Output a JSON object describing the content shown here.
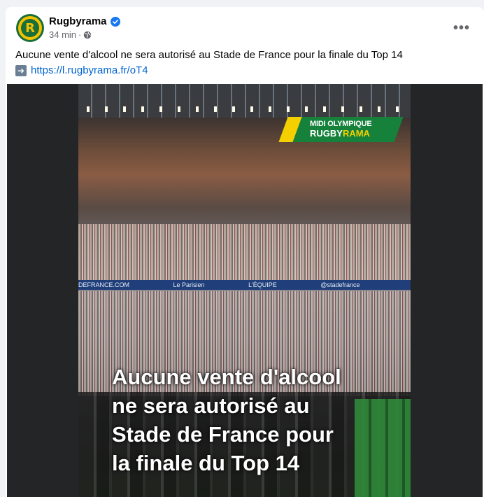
{
  "post": {
    "page_name": "Rugbyrama",
    "time": "34 min",
    "separator": "·",
    "text": "Aucune vente d'alcool ne sera autorisé au Stade de France pour la finale du Top 14",
    "link_text": "https://l.rugbyrama.fr/oT4",
    "more_label": "•••"
  },
  "avatar": {
    "letter": "R"
  },
  "media": {
    "logo_line1": "MIDI OLYMPIQUE",
    "logo_line2_a": "RUGBY",
    "logo_line2_b": "RAMA",
    "headline": "Aucune vente d'alcool\nne sera autorisé au\nStade de France pour\nla finale du Top 14",
    "banner_texts": [
      "DEFRANCE.COM",
      "Le Parisien",
      "L'ÉQUIPE",
      "@stadefrance"
    ]
  },
  "colors": {
    "link": "#0064d1",
    "verified": "#1877f2",
    "logo_green": "#16813b",
    "logo_yellow": "#f4d000"
  },
  "icons": [
    "verified-badge-icon",
    "globe-icon",
    "more-options-icon",
    "right-arrow-icon"
  ]
}
